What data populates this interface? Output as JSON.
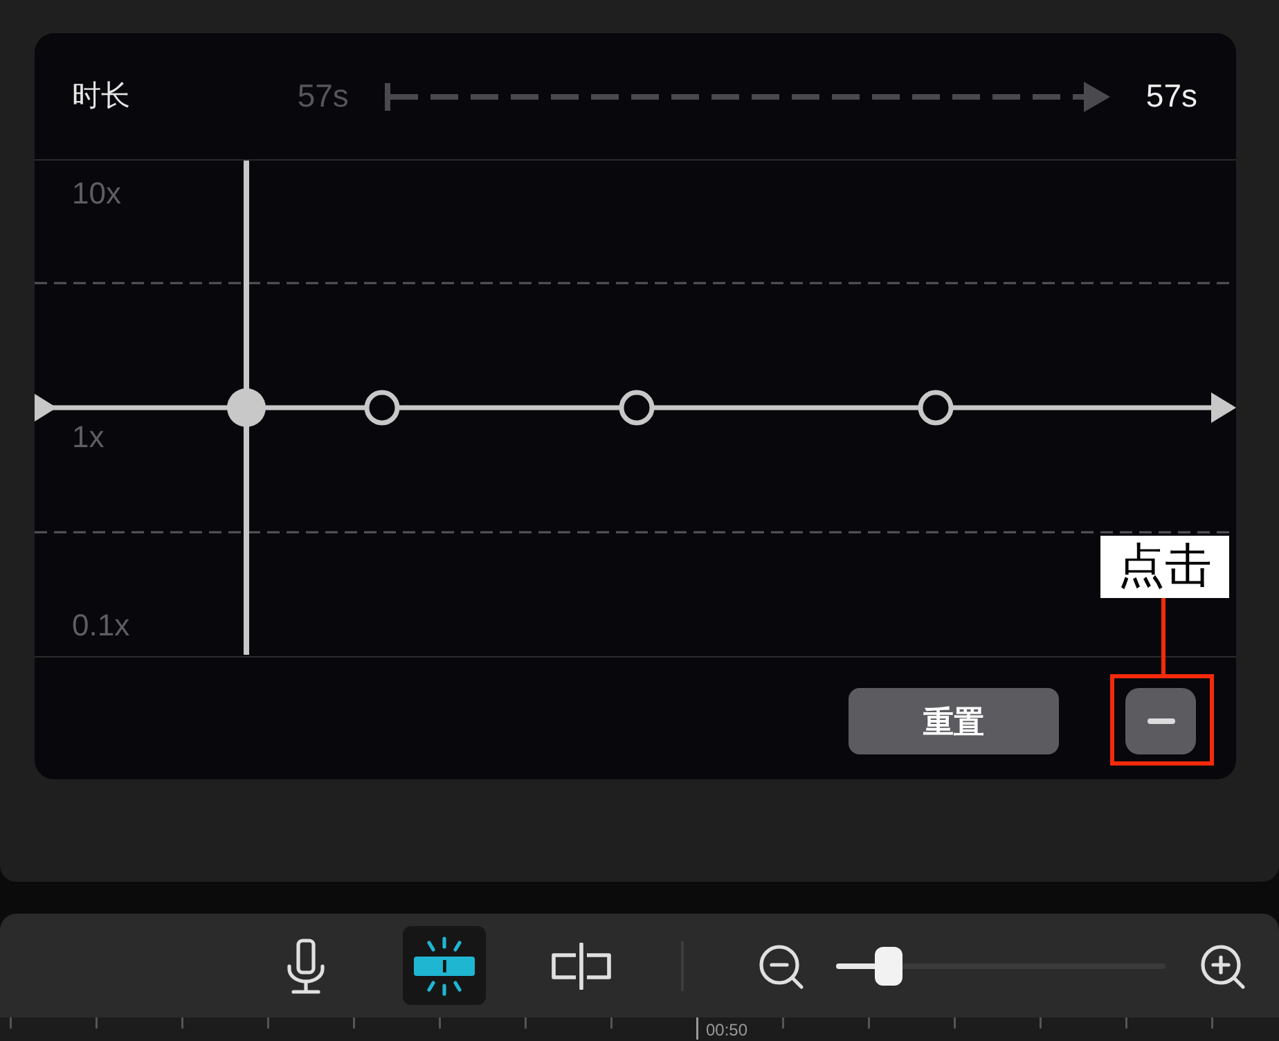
{
  "duration": {
    "label": "时长",
    "from": "57s",
    "to": "57s"
  },
  "curve": {
    "y_labels": [
      "10x",
      "1x",
      "0.1x"
    ],
    "points": [
      {
        "selected": true
      },
      {
        "selected": false
      },
      {
        "selected": false
      },
      {
        "selected": false
      }
    ]
  },
  "actions": {
    "reset": "重置"
  },
  "callout": {
    "label": "点击"
  },
  "toolbar": {
    "tools": [
      {
        "kind": "mic",
        "selected": false
      },
      {
        "kind": "snap",
        "selected": true
      },
      {
        "kind": "split",
        "selected": false
      }
    ],
    "zoom": {
      "level": 0.16
    }
  },
  "timeline": {
    "time_label": "00:50"
  }
}
